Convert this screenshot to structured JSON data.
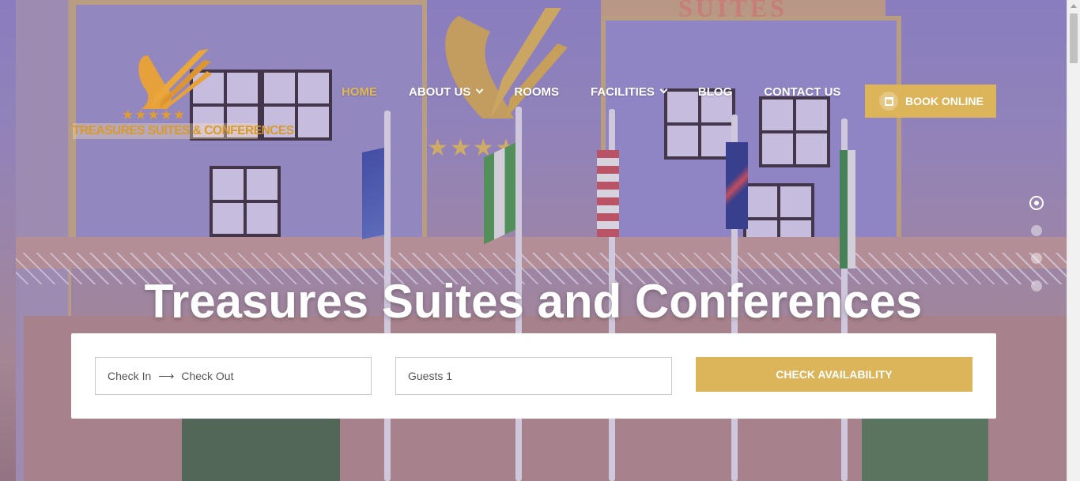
{
  "header": {
    "logo_text": "TREASURES SUITES & CONFERENCES",
    "logo_stars": "★★★★★",
    "nav": [
      {
        "label": "HOME",
        "active": true,
        "dropdown": false
      },
      {
        "label": "ABOUT US",
        "active": false,
        "dropdown": true
      },
      {
        "label": "ROOMS",
        "active": false,
        "dropdown": false
      },
      {
        "label": "FACILITIES",
        "active": false,
        "dropdown": true
      },
      {
        "label": "BLOG",
        "active": false,
        "dropdown": false
      },
      {
        "label": "CONTACT US",
        "active": false,
        "dropdown": false
      }
    ],
    "book_label": "BOOK ONLINE",
    "book_icon": "calendar-icon"
  },
  "hero": {
    "headline": "Treasures Suites and Conferences",
    "slide_count": 4,
    "active_slide": 1,
    "sign_text": "SUITES",
    "facade_stars": "★★★★"
  },
  "booking": {
    "check_in": "Check In",
    "arrow": "⟶",
    "check_out": "Check Out",
    "guests": "Guests 1",
    "submit_label": "CHECK AVAILABILITY"
  },
  "colors": {
    "accent": "#dcb55b",
    "nav_active": "#e2b856",
    "text_white": "#ffffff"
  }
}
